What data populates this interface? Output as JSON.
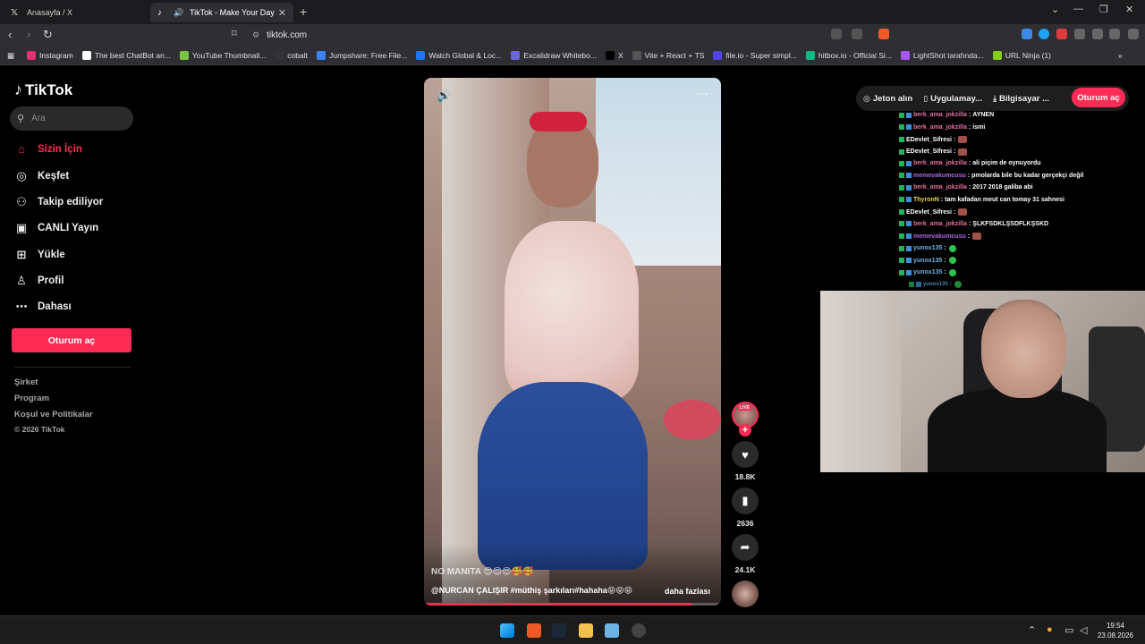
{
  "browser": {
    "tabs": [
      {
        "title": "Anasayfa / X",
        "icon": "x-icon"
      },
      {
        "title": "TikTok - Make Your Day",
        "icon": "tiktok-icon"
      }
    ],
    "url": "tiktok.com",
    "bookmarks": [
      {
        "label": "Instagram",
        "icon": "instagram-icon",
        "color": "#e1306c"
      },
      {
        "label": "The best ChatBot an...",
        "icon": "chatbot-icon",
        "color": "#ffffff"
      },
      {
        "label": "YouTube Thumbnail...",
        "icon": "youtube-icon",
        "color": "#7cc242"
      },
      {
        "label": "cobalt",
        "icon": "cobalt-icon",
        "color": "#333333"
      },
      {
        "label": "Jumpshare: Free File...",
        "icon": "jumpshare-icon",
        "color": "#3b82f6"
      },
      {
        "label": "Watch Global & Loc...",
        "icon": "facebook-icon",
        "color": "#1877f2"
      },
      {
        "label": "Excalidraw Whitebo...",
        "icon": "excalidraw-icon",
        "color": "#6965db"
      },
      {
        "label": "X",
        "icon": "x-icon",
        "color": "#000000"
      },
      {
        "label": "Vite + React + TS",
        "icon": "globe-icon",
        "color": "#555555"
      },
      {
        "label": "file.io - Super simpl...",
        "icon": "fileio-icon",
        "color": "#4f46e5"
      },
      {
        "label": "hitbox.io - Official Si...",
        "icon": "hitbox-icon",
        "color": "#10b981"
      },
      {
        "label": "LightShot tarafında...",
        "icon": "lightshot-icon",
        "color": "#a855f7"
      },
      {
        "label": "URL Ninja (1)",
        "icon": "ninja-icon",
        "color": "#84cc16"
      }
    ]
  },
  "tiktok": {
    "logo": "TikTok",
    "search_placeholder": "Ara",
    "menu": [
      {
        "label": "Sizin İçin",
        "icon": "home-icon",
        "active": true
      },
      {
        "label": "Keşfet",
        "icon": "compass-icon",
        "active": false
      },
      {
        "label": "Takip ediliyor",
        "icon": "following-icon",
        "active": false
      },
      {
        "label": "CANLI Yayın",
        "icon": "live-icon",
        "active": false
      },
      {
        "label": "Yükle",
        "icon": "upload-icon",
        "active": false
      },
      {
        "label": "Profil",
        "icon": "profile-icon",
        "active": false
      },
      {
        "label": "Dahası",
        "icon": "more-icon",
        "active": false
      }
    ],
    "login_label": "Oturum aç",
    "footer": [
      "Şirket",
      "Program",
      "Koşul ve Politikalar",
      "© 2026 TikTok"
    ],
    "header": {
      "coins": "Jeton alın",
      "app": "Uygulamay...",
      "computer": "Bilgisayar ...",
      "login": "Oturum aç"
    },
    "video": {
      "title": "NO MANITA 😍😍😍🥰🥰",
      "description": "@NURCAN ÇALIŞIR #müthiş şarkıları#hahaha😝😝😝",
      "more": "daha fazlası",
      "progress": 0.9,
      "live_badge": "LIVE",
      "likes": "18.8K",
      "saves": "2636",
      "shares": "24.1K"
    }
  },
  "chat": [
    {
      "user": "berk_ama_jokzilla",
      "color": "#e66ea2",
      "msg": "AYNEN",
      "emote": ""
    },
    {
      "user": "berk_ama_jokzilla",
      "color": "#e66ea2",
      "msg": "ismi",
      "emote": ""
    },
    {
      "user": "EDevlet_Sifresi",
      "color": "#ffffff",
      "msg": "",
      "emote": "image"
    },
    {
      "user": "EDevlet_Sifresi",
      "color": "#ffffff",
      "msg": "",
      "emote": "image"
    },
    {
      "user": "berk_ama_jokzilla",
      "color": "#e66ea2",
      "msg": "ali piçim de oynuyordu",
      "emote": ""
    },
    {
      "user": "memevakumcusu",
      "color": "#b268e3",
      "msg": "pmolarda bile bu kadar gerçekçi değil",
      "emote": ""
    },
    {
      "user": "berk_ama_jokzilla",
      "color": "#e66ea2",
      "msg": "2017 2018 galiba abi",
      "emote": ""
    },
    {
      "user": "ThyronN",
      "color": "#f2d13c",
      "msg": "tam kafadan meut can tomay 31 sahnesi",
      "emote": ""
    },
    {
      "user": "EDevlet_Sifresi",
      "color": "#ffffff",
      "msg": "",
      "emote": "image"
    },
    {
      "user": "berk_ama_jokzilla",
      "color": "#e66ea2",
      "msg": "ŞLKFSDKLŞSDFLKŞSKD",
      "emote": ""
    },
    {
      "user": "memevakumcusu",
      "color": "#b268e3",
      "msg": "",
      "emote": "image"
    },
    {
      "user": "yunox135",
      "color": "#6fb2e8",
      "msg": "",
      "emote": "green"
    },
    {
      "user": "yunox135",
      "color": "#6fb2e8",
      "msg": "",
      "emote": "green"
    },
    {
      "user": "yunox135",
      "color": "#6fb2e8",
      "msg": "",
      "emote": "green"
    },
    {
      "user": "yunox135",
      "color": "#6fb2e8",
      "msg": "",
      "emote": "green"
    }
  ],
  "clock": {
    "time": "19:54",
    "date": "23.08.2026"
  }
}
